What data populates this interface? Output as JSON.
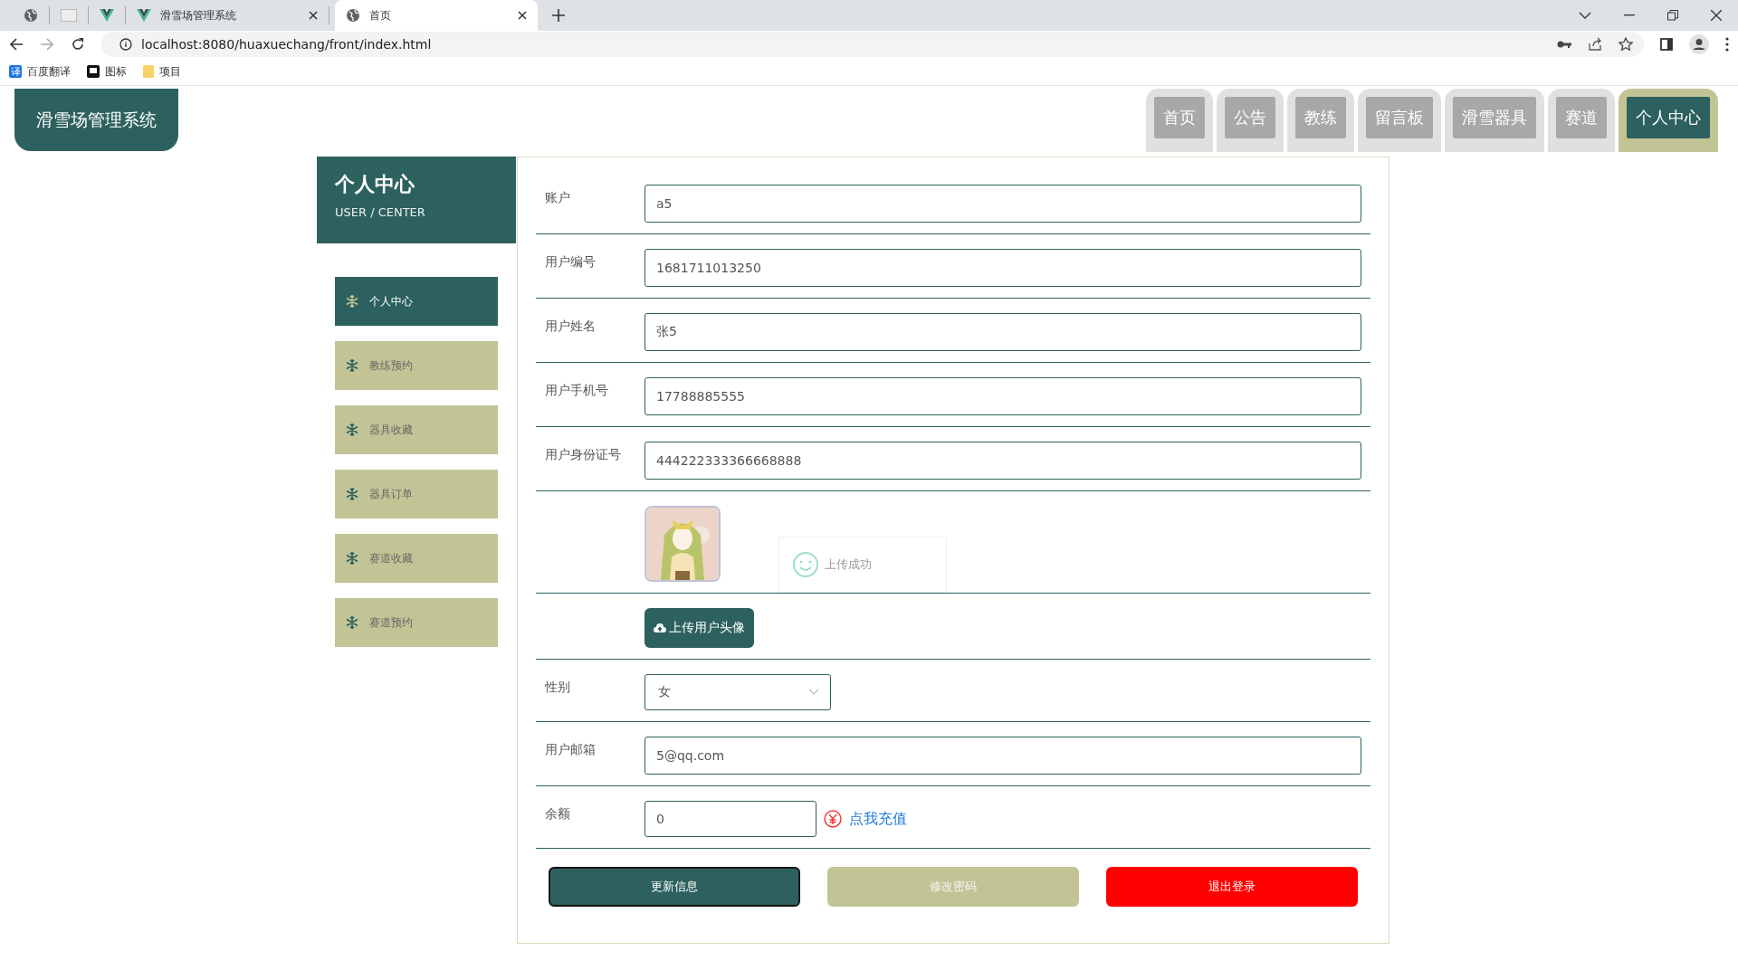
{
  "browser": {
    "tabs": [
      {
        "kind": "globe",
        "selected": false
      },
      {
        "kind": "blank",
        "selected": false
      },
      {
        "kind": "vue",
        "selected": false
      },
      {
        "kind": "vue",
        "title": "滑雪场管理系统",
        "selected": false
      },
      {
        "kind": "globe",
        "title": "首页",
        "selected": true
      }
    ],
    "url": "localhost:8080/huaxuechang/front/index.html",
    "bookmarks": [
      {
        "kind": "translate",
        "glyph": "译",
        "label": "百度翻译"
      },
      {
        "kind": "flag",
        "label": "图标"
      },
      {
        "kind": "folder",
        "label": "项目"
      }
    ]
  },
  "site": {
    "logo": "滑雪场管理系统",
    "nav": [
      {
        "label": "首页",
        "selected": false
      },
      {
        "label": "公告",
        "selected": false
      },
      {
        "label": "教练",
        "selected": false
      },
      {
        "label": "留言板",
        "selected": false
      },
      {
        "label": "滑雪器具",
        "selected": false
      },
      {
        "label": "赛道",
        "selected": false
      },
      {
        "label": "个人中心",
        "selected": true
      }
    ]
  },
  "sidebar": {
    "title": "个人中心",
    "subtitle": "USER / CENTER",
    "items": [
      {
        "label": "个人中心",
        "selected": true
      },
      {
        "label": "教练预约",
        "selected": false
      },
      {
        "label": "器具收藏",
        "selected": false
      },
      {
        "label": "器具订单",
        "selected": false
      },
      {
        "label": "赛道收藏",
        "selected": false
      },
      {
        "label": "赛道预约",
        "selected": false
      }
    ]
  },
  "form": {
    "fields": [
      {
        "kind": "text",
        "label": "账户",
        "value": "a5"
      },
      {
        "kind": "text",
        "label": "用户编号",
        "value": "1681711013250"
      },
      {
        "kind": "text",
        "label": "用户姓名",
        "value": "张5"
      },
      {
        "kind": "text",
        "label": "用户手机号",
        "value": "17788885555"
      },
      {
        "kind": "text",
        "label": "用户身份证号",
        "value": "444222333366668888"
      },
      {
        "kind": "avatar"
      },
      {
        "kind": "upload",
        "value": "上传用户头像"
      },
      {
        "kind": "select",
        "label": "性别",
        "value": "女"
      },
      {
        "kind": "text",
        "label": "用户邮箱",
        "value": "5@qq.com"
      },
      {
        "kind": "balance",
        "label": "余额",
        "value": "0",
        "link": "点我充值"
      }
    ],
    "toast": "上传成功",
    "buttons": [
      {
        "kind": "primary",
        "label": "更新信息"
      },
      {
        "kind": "secondary",
        "label": "修改密码"
      },
      {
        "kind": "danger",
        "label": "退出登录"
      }
    ]
  }
}
